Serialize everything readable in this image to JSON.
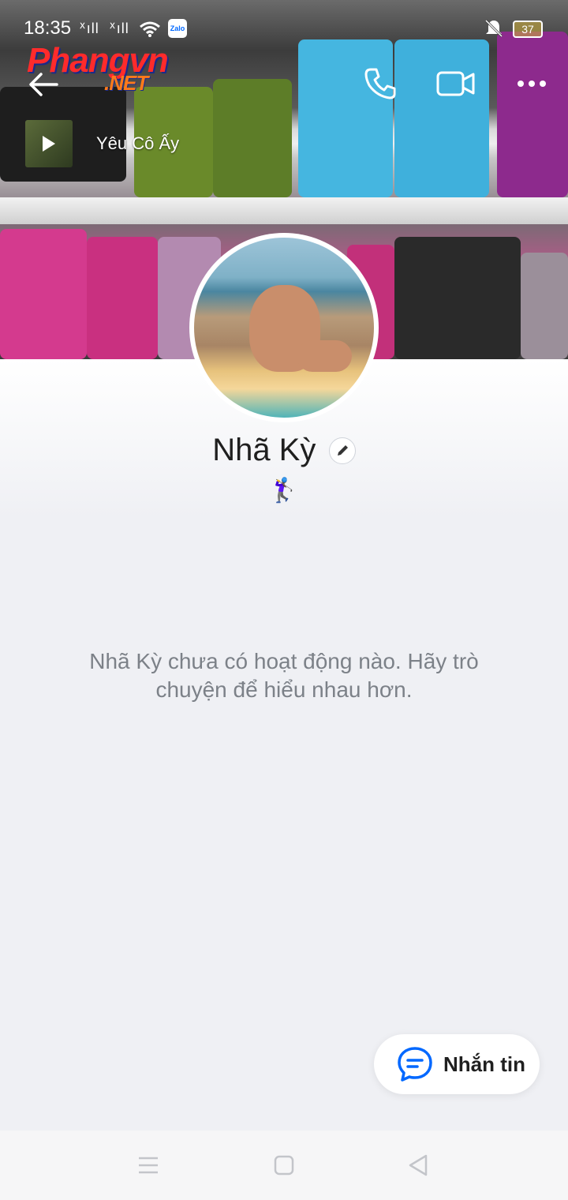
{
  "status_bar": {
    "time": "18:35",
    "signal1": "ᕽıll",
    "signal2": "ᕽıll",
    "app_badge": "Zalo",
    "battery": "37"
  },
  "watermark": {
    "main": "Phangvn",
    "suffix": ".NET"
  },
  "header": {
    "music_title": "Yêu Cô Ấy"
  },
  "profile": {
    "name": "Nhã Kỳ",
    "bio_emoji": "🏌️‍♀️",
    "empty_message": "Nhã Kỳ chưa có hoạt động nào. Hãy trò chuyện để hiểu nhau hơn."
  },
  "fab": {
    "label": "Nhắn tin"
  },
  "colors": {
    "accent": "#0068ff",
    "background": "#eff0f4",
    "muted_text": "#7c8188"
  },
  "icons": [
    "back-arrow-icon",
    "phone-icon",
    "video-call-icon",
    "more-icon",
    "play-icon",
    "edit-pencil-icon",
    "chat-bubble-icon",
    "menu-icon",
    "home-icon",
    "back-triangle-icon"
  ]
}
